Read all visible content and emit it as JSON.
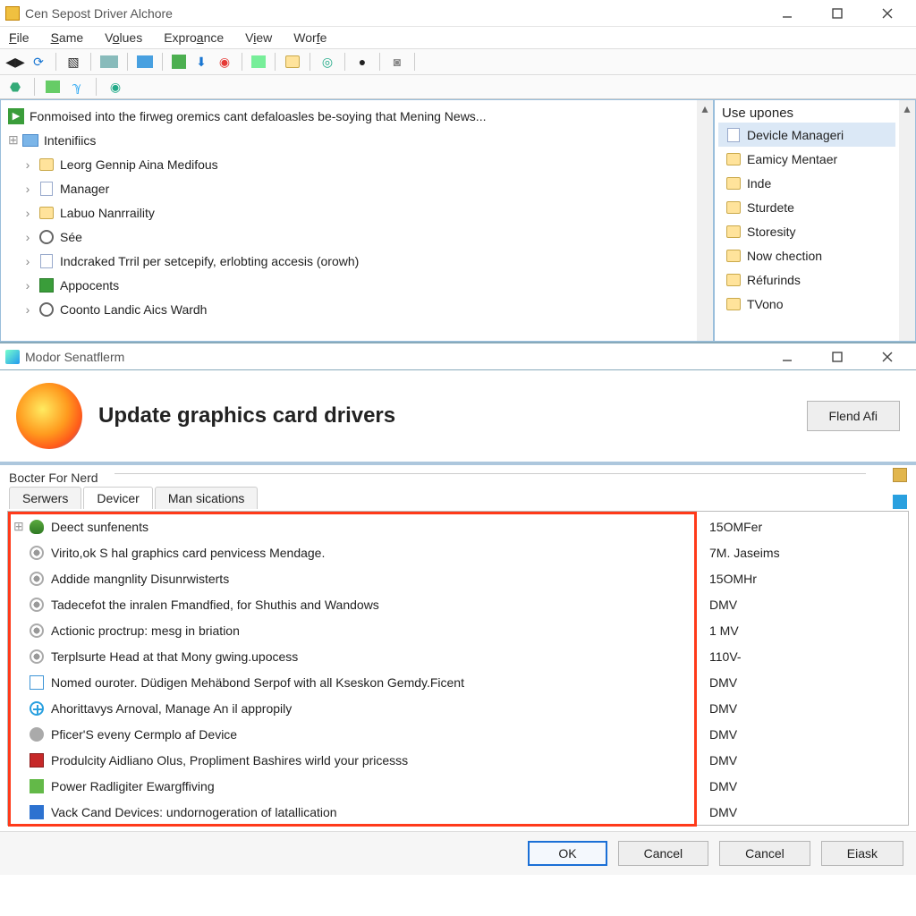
{
  "win1": {
    "title": "Cen Sepost Driver Alchore",
    "menu": [
      "File",
      "Same",
      "Volues",
      "Exproance",
      "View",
      "Worfe"
    ],
    "headline": "Fonmoised into the firweg oremics cant defaloasles be-soying that Mening News...",
    "root": "Intenifiics",
    "items": [
      {
        "icon": "folder",
        "label": "Leorg Gennip Aina Medifous"
      },
      {
        "icon": "file",
        "label": "Manager"
      },
      {
        "icon": "folder",
        "label": "Labuo Nanrraility"
      },
      {
        "icon": "gear",
        "label": "Sée"
      },
      {
        "icon": "file",
        "label": "Indcraked Trril per setcepify, erlobting accesis (orowh)"
      },
      {
        "icon": "app",
        "label": "Appocents"
      },
      {
        "icon": "gear",
        "label": "Coonto Landic Aics Wardh"
      }
    ],
    "right_header": "Use upones",
    "right_items": [
      {
        "label": "Devicle Manageri",
        "sel": true,
        "icon": "file"
      },
      {
        "label": "Eamicy Mentaer",
        "icon": "folder"
      },
      {
        "label": "Inde",
        "icon": "folder"
      },
      {
        "label": "Sturdete",
        "icon": "folder"
      },
      {
        "label": "Storesity",
        "icon": "folder"
      },
      {
        "label": "Now chection",
        "icon": "folder"
      },
      {
        "label": "Réfurinds",
        "icon": "folder"
      },
      {
        "label": "TVono",
        "icon": "folder"
      }
    ]
  },
  "win2": {
    "title": "Modor Senatflerm",
    "hero": "Update graphics card drivers",
    "flend": "Flend Afi",
    "group": "Bocter For Nerd",
    "tabs": [
      "Serwers",
      "Devicer",
      "Man sications"
    ],
    "rows": [
      {
        "icon": "tree",
        "label": "Deect sunfenents",
        "val": "15OMFer"
      },
      {
        "icon": "gear2",
        "label": "Virito,ok S hal graphics card penvicess Mendage.",
        "val": "7M. Jaseims"
      },
      {
        "icon": "gear2",
        "label": "Addide mangnlity Disunrwisterts",
        "val": "15OMHr"
      },
      {
        "icon": "gear2",
        "label": "Tadecefot the inralen Fmandfied, for Shuthis and Wandows",
        "val": "DMV"
      },
      {
        "icon": "gear2",
        "label": "Actionic proctrup: mesg in briation",
        "val": "1 MV"
      },
      {
        "icon": "gear2",
        "label": "Terplsurte Head at that Mony gwing.upocess",
        "val": "110V-"
      },
      {
        "icon": "doc",
        "label": "Nomed ouroter. Düdigen Mehäbond Serpof with all Kseskon Gemdy.Ficent",
        "val": "DMV"
      },
      {
        "icon": "plus",
        "label": "Ahorittavys Arnoval, Manage An il appropily",
        "val": "DMV"
      },
      {
        "icon": "info",
        "label": "Pficer'S eveny Cermplo af Device",
        "val": "DMV"
      },
      {
        "icon": "red",
        "label": "Produlcity Aidliano Olus, Propliment Bashires wirld your pricesss",
        "val": "DMV"
      },
      {
        "icon": "green",
        "label": "Power Radligiter Ewargffiving",
        "val": "DMV"
      },
      {
        "icon": "bluebox",
        "label": "Vack Cand Devices: undornogeration of latallication",
        "val": "DMV"
      }
    ],
    "buttons": [
      "OK",
      "Cancel",
      "Cancel",
      "Eiask"
    ]
  }
}
